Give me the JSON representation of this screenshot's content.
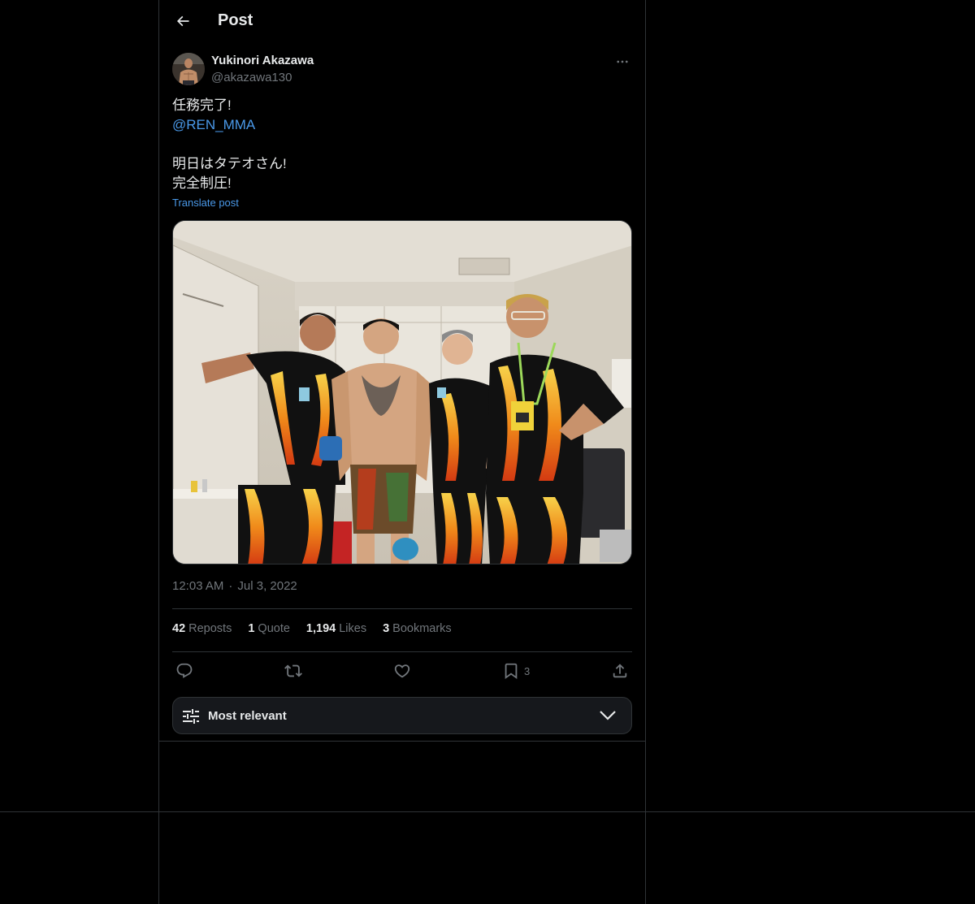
{
  "header": {
    "title": "Post",
    "back_icon": "arrow-left-icon"
  },
  "author": {
    "name": "Yukinori Akazawa",
    "handle": "@akazawa130",
    "more_icon": "more-horizontal-icon"
  },
  "tweet": {
    "lines": [
      {
        "text": "任務完了!",
        "type": "text"
      },
      {
        "text": "@REN_MMA",
        "type": "mention"
      },
      {
        "text": " ",
        "type": "text"
      },
      {
        "text": "明日はタテオさん!",
        "type": "text"
      },
      {
        "text": "完全制圧!",
        "type": "text"
      }
    ],
    "translate_label": "Translate post"
  },
  "timestamp": {
    "time": "12:03 AM",
    "separator": "·",
    "date": "Jul 3, 2022"
  },
  "stats": [
    {
      "count": "42",
      "label": "Reposts"
    },
    {
      "count": "1",
      "label": "Quote"
    },
    {
      "count": "1,194",
      "label": "Likes"
    },
    {
      "count": "3",
      "label": "Bookmarks"
    }
  ],
  "actions": {
    "reply_icon": "reply-icon",
    "repost_icon": "repost-icon",
    "like_icon": "heart-icon",
    "bookmark_icon": "bookmark-icon",
    "bookmark_count": "3",
    "share_icon": "share-icon"
  },
  "sort": {
    "label": "Most relevant",
    "icon": "sliders-icon",
    "chevron": "chevron-down-icon"
  },
  "colors": {
    "background": "#000000",
    "text": "#e7e9ea",
    "muted": "#71767b",
    "accent": "#4a99e9",
    "border": "#2f3336"
  }
}
